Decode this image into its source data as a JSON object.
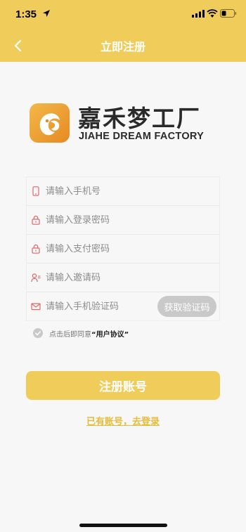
{
  "status_bar": {
    "time": "1:35"
  },
  "header": {
    "title": "立即注册"
  },
  "brand": {
    "name_cn": "嘉禾梦工厂",
    "name_en": "JIAHE DREAM FACTORY"
  },
  "form": {
    "phone_placeholder": "请输入手机号",
    "login_password_placeholder": "请输入登录密码",
    "pay_password_placeholder": "请输入支付密码",
    "invite_code_placeholder": "请输入邀请码",
    "sms_code_placeholder": "请输入手机验证码",
    "get_code_label": "获取验证码"
  },
  "agreement": {
    "prefix": "点击后即同意",
    "link": "“用户协议”"
  },
  "register_label": "注册账号",
  "login_link": "已有账号，去登录",
  "colors": {
    "accent": "#f0cd5a",
    "icon": "#e06666",
    "link": "#e4bd3d"
  },
  "icons": [
    "location-arrow-icon",
    "signal-icon",
    "wifi-icon",
    "battery-icon",
    "back-chevron-icon",
    "phone-icon",
    "lock-icon",
    "user-invite-icon",
    "mail-icon",
    "check-circle-icon"
  ]
}
